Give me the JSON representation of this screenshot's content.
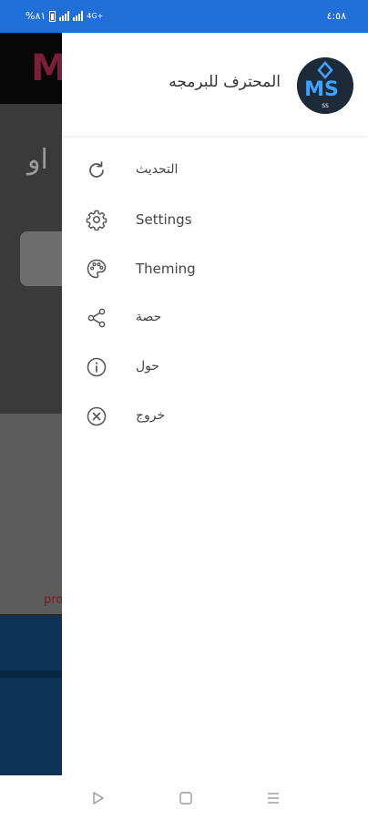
{
  "status_bar": {
    "time": "٤:٥٨",
    "battery": "%٨١",
    "network_label": "4G+"
  },
  "background_app": {
    "logo_letter": "M",
    "headline_fragment": "او",
    "footer_fragment": "pro"
  },
  "drawer": {
    "app_title": "المحترف للبرمجه",
    "avatar_text": "MS",
    "avatar_sub": "SS",
    "menu": [
      {
        "label": "التحديث",
        "icon": "refresh-icon"
      },
      {
        "label": "Settings",
        "icon": "gear-icon"
      },
      {
        "label": "Theming",
        "icon": "palette-icon"
      },
      {
        "label": "حصة",
        "icon": "share-icon"
      },
      {
        "label": "حول",
        "icon": "info-icon"
      },
      {
        "label": "خروج",
        "icon": "close-circle-icon"
      }
    ]
  },
  "nav_bar": {
    "buttons": [
      "back-triangle-icon",
      "home-square-icon",
      "recents-lines-icon"
    ]
  },
  "colors": {
    "status_bar": "#1f6fd6",
    "drawer_bg": "#ffffff",
    "icon": "#555555",
    "text": "#444444"
  }
}
